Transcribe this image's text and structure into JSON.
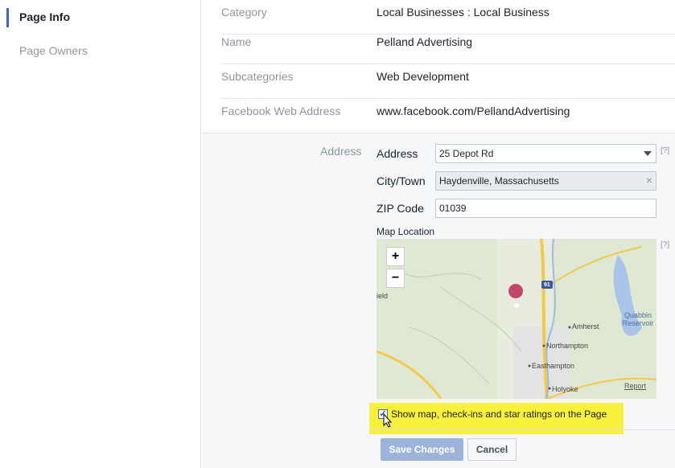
{
  "sidebar": {
    "items": [
      {
        "label": "Page Info",
        "active": true
      },
      {
        "label": "Page Owners",
        "active": false
      }
    ]
  },
  "info": {
    "rows": [
      {
        "label": "Category",
        "value": "Local Businesses : Local Business"
      },
      {
        "label": "Name",
        "value": "Pelland Advertising"
      },
      {
        "label": "Subcategories",
        "value": "Web Development"
      },
      {
        "label": "Facebook Web Address",
        "value": "www.facebook.com/PellandAdvertising"
      }
    ]
  },
  "address_section": {
    "label": "Address",
    "address_label": "Address",
    "address_value": "25 Depot Rd",
    "city_label": "City/Town",
    "city_value": "Haydenville, Massachusetts",
    "zip_label": "ZIP Code",
    "zip_value": "01039",
    "help_text": "[?]",
    "map_label": "Map Location",
    "map": {
      "zoom_in": "+",
      "zoom_out": "−",
      "route_label": "91",
      "places": [
        "Amherst",
        "Northampton",
        "Easthampton",
        "Holyoke"
      ],
      "water": "Quabbin Reservoir",
      "field_fragment": "ield",
      "report": "Report"
    },
    "checkbox_label": "Show map, check-ins and star ratings on the Page",
    "checkbox_checked": true
  },
  "buttons": {
    "save": "Save Changes",
    "cancel": "Cancel"
  },
  "colors": {
    "accent": "#4267b2",
    "highlight": "#f7f03c",
    "map_pin": "#c2476b"
  }
}
